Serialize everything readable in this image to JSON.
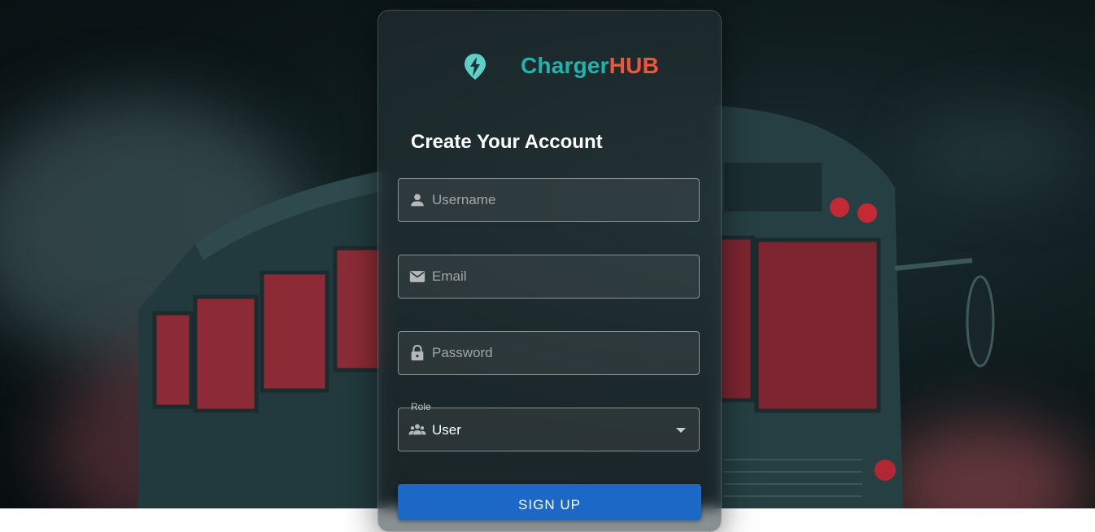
{
  "brand": {
    "part1": "Charger",
    "part2": "HUB",
    "logo_icon": "location-bolt-icon",
    "color_primary": "#1fb5ac",
    "color_secondary": "#f2553c"
  },
  "form": {
    "title": "Create Your Account",
    "username": {
      "placeholder": "Username",
      "value": "",
      "icon": "person-icon"
    },
    "email": {
      "placeholder": "Email",
      "value": "",
      "icon": "mail-icon"
    },
    "password": {
      "placeholder": "Password",
      "value": "",
      "icon": "lock-icon"
    },
    "role": {
      "label": "Role",
      "value": "User",
      "icon": "group-icon"
    },
    "submit_label": "SIGN UP",
    "submit_color": "#1c68c6"
  }
}
